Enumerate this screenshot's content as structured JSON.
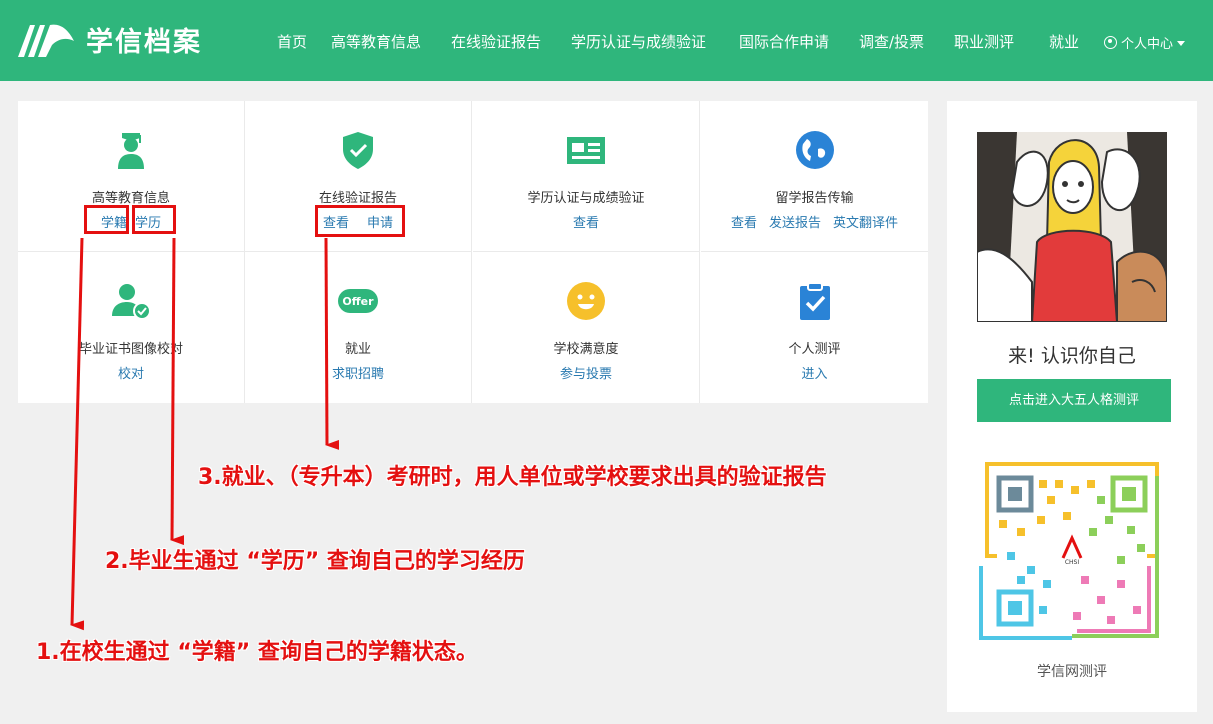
{
  "header": {
    "logo_text": "学信档案",
    "nav": [
      {
        "label": "首页"
      },
      {
        "label": "高等教育信息"
      },
      {
        "label": "在线验证报告"
      },
      {
        "label": "学历认证与成绩验证"
      },
      {
        "label": "国际合作申请"
      },
      {
        "label": "调查/投票"
      },
      {
        "label": "职业测评"
      },
      {
        "label": "就业"
      }
    ],
    "user_center": "个人中心"
  },
  "services": [
    {
      "title": "高等教育信息",
      "icon": "graduate-icon",
      "links": [
        "学籍",
        "学历"
      ]
    },
    {
      "title": "在线验证报告",
      "icon": "shield-check-icon",
      "links": [
        "查看",
        "申请"
      ]
    },
    {
      "title": "学历认证与成绩验证",
      "icon": "id-card-icon",
      "links": [
        "查看"
      ]
    },
    {
      "title": "留学报告传输",
      "icon": "globe-icon",
      "links": [
        "查看",
        "发送报告",
        "英文翻译件"
      ]
    },
    {
      "title": "毕业证书图像校对",
      "icon": "user-check-icon",
      "links": [
        "校对"
      ]
    },
    {
      "title": "就业",
      "icon": "offer-icon",
      "icon_text": "Offer",
      "links": [
        "求职招聘"
      ]
    },
    {
      "title": "学校满意度",
      "icon": "smiley-icon",
      "links": [
        "参与投票"
      ]
    },
    {
      "title": "个人测评",
      "icon": "clipboard-check-icon",
      "links": [
        "进入"
      ]
    }
  ],
  "side": {
    "slogan": "来! 认识你自己",
    "button": "点击进入大五人格测评",
    "qr_caption": "学信网测评",
    "qr_brand": "CHSI"
  },
  "annotations": {
    "note1": "1.在校生通过 “学籍” 查询自己的学籍状态。",
    "note2": "2.毕业生通过 “学历” 查询自己的学习经历",
    "note3": "3.就业、（专升本）考研时，用人单位或学校要求出具的验证报告"
  },
  "colors": {
    "brand_green": "#2fb67c",
    "link_blue": "#2a7ab0",
    "annotation_red": "#e41010"
  }
}
